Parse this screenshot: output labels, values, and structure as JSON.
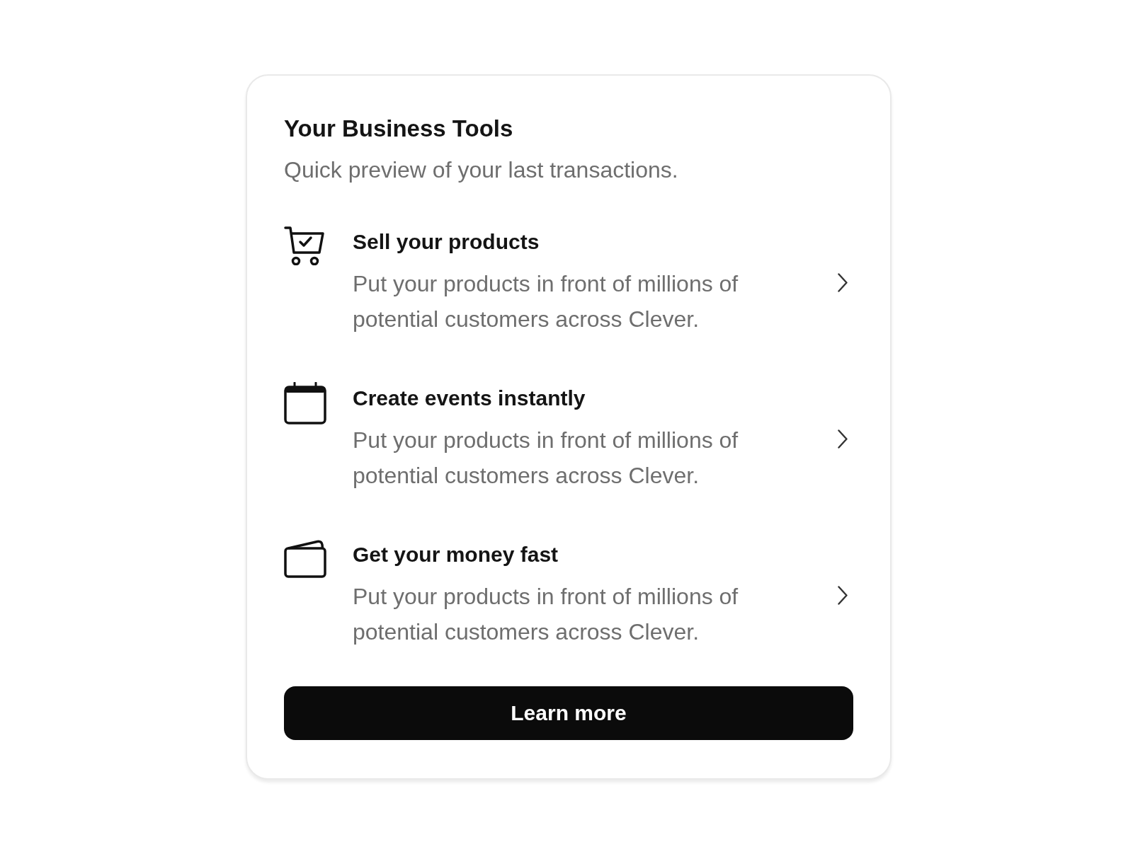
{
  "card": {
    "title": "Your Business Tools",
    "subtitle": "Quick preview of your last transactions."
  },
  "items": [
    {
      "kind": "cart",
      "title": "Sell your products",
      "description": "Put your products in front of millions of potential customers across Clever."
    },
    {
      "kind": "calendar",
      "title": "Create events instantly",
      "description": "Put your products in front of millions of potential customers across Clever."
    },
    {
      "kind": "wallet",
      "title": "Get your money fast",
      "description": "Put your products in front of millions of potential customers across Clever."
    }
  ],
  "button": {
    "label": "Learn more"
  }
}
